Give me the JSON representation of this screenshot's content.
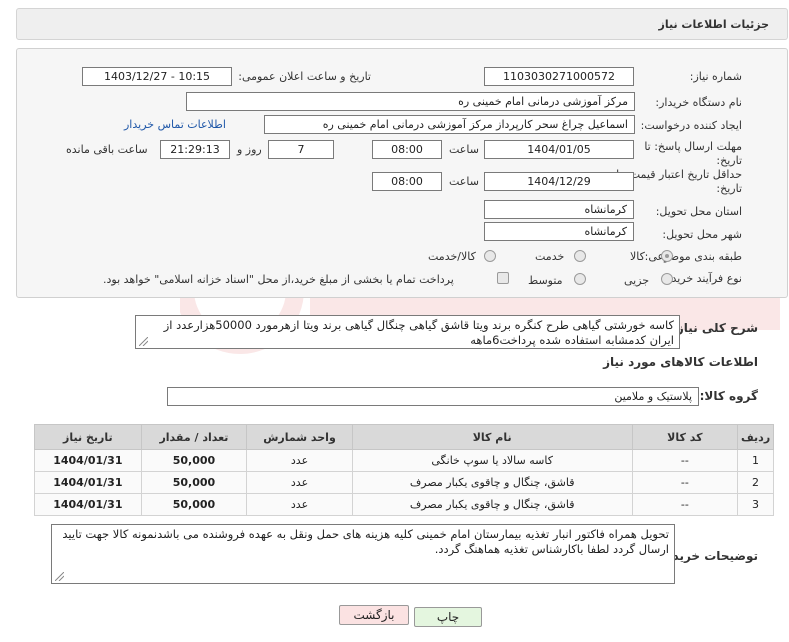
{
  "header": {
    "title": "جزئیات اطلاعات نیاز"
  },
  "form": {
    "need_number_label": "شماره نیاز:",
    "need_number": "1103030271000572",
    "announce_label": "تاریخ و ساعت اعلان عمومی:",
    "announce_value": "1403/12/27 - 10:15",
    "buyer_org_label": "نام دستگاه خریدار:",
    "buyer_org": "مرکز آموزشی درمانی امام خمینی ره",
    "requester_label": "ایجاد کننده درخواست:",
    "requester": "اسماعیل چراغ سحر کارپرداز مرکز آموزشی درمانی امام خمینی ره",
    "contact_link": "اطلاعات تماس خریدار",
    "deadline_label_1": "مهلت ارسال پاسخ: تا",
    "deadline_label_2": "تاریخ:",
    "deadline_date": "1404/01/05",
    "time_label": "ساعت",
    "deadline_time": "08:00",
    "days_value": "7",
    "days_label": "روز و",
    "remaining_time": "21:29:13",
    "remaining_label": "ساعت باقی مانده",
    "validity_label_1": "حداقل تاریخ اعتبار قیمت: تا",
    "validity_label_2": "تاریخ:",
    "validity_date": "1404/12/29",
    "validity_time": "08:00",
    "province_label": "استان محل تحویل:",
    "province": "کرمانشاه",
    "city_label": "شهر محل تحویل:",
    "city": "کرمانشاه",
    "category_label": "طبقه بندی موضوعی:",
    "category_options": [
      "کالا",
      "خدمت",
      "کالا/خدمت"
    ],
    "process_label": "نوع فرآیند خرید :",
    "process_options": [
      "جزیی",
      "متوسط"
    ],
    "payment_note": "پرداخت تمام یا بخشی از مبلغ خرید،از محل \"اسناد خزانه اسلامی\" خواهد بود."
  },
  "description": {
    "label": "شرح کلی نیاز:",
    "text": "کاسه خورشتی گیاهی طرح کنگره برند ویتا قاشق گیاهی چنگال گیاهی برند ویتا ازهرمورد 50000هزارعدد از ایران کدمشابه استفاده شده پرداخت6ماهه"
  },
  "goods": {
    "section_title": "اطلاعات کالاهای مورد نیاز",
    "group_label": "گروه کالا:",
    "group_value": "پلاستیک و ملامین",
    "columns": [
      "ردیف",
      "کد کالا",
      "نام کالا",
      "واحد شمارش",
      "تعداد / مقدار",
      "تاریخ نیاز"
    ],
    "rows": [
      {
        "row": "1",
        "code": "--",
        "name": "کاسه سالاد یا سوپ خانگی",
        "unit": "عدد",
        "qty": "50,000",
        "date": "1404/01/31"
      },
      {
        "row": "2",
        "code": "--",
        "name": "قاشق، چنگال و چاقوی یکبار مصرف",
        "unit": "عدد",
        "qty": "50,000",
        "date": "1404/01/31"
      },
      {
        "row": "3",
        "code": "--",
        "name": "قاشق، چنگال و چاقوی یکبار مصرف",
        "unit": "عدد",
        "qty": "50,000",
        "date": "1404/01/31"
      }
    ]
  },
  "notes": {
    "label": "توضیحات خریدار:",
    "text": "تحویل همراه فاکتور انبار تغذیه بیمارستان امام خمینی کلیه هزینه های حمل ونقل به عهده فروشنده می باشدنمونه کالا جهت تایید ارسال گردد لطفا باکارشناس تغذیه هماهنگ گردد."
  },
  "buttons": {
    "print": "چاپ",
    "back": "بازگشت"
  },
  "colors": {
    "accent_link": "#1f57a8",
    "print_bg": "#e4f6df",
    "back_bg": "#fbe2e2"
  }
}
